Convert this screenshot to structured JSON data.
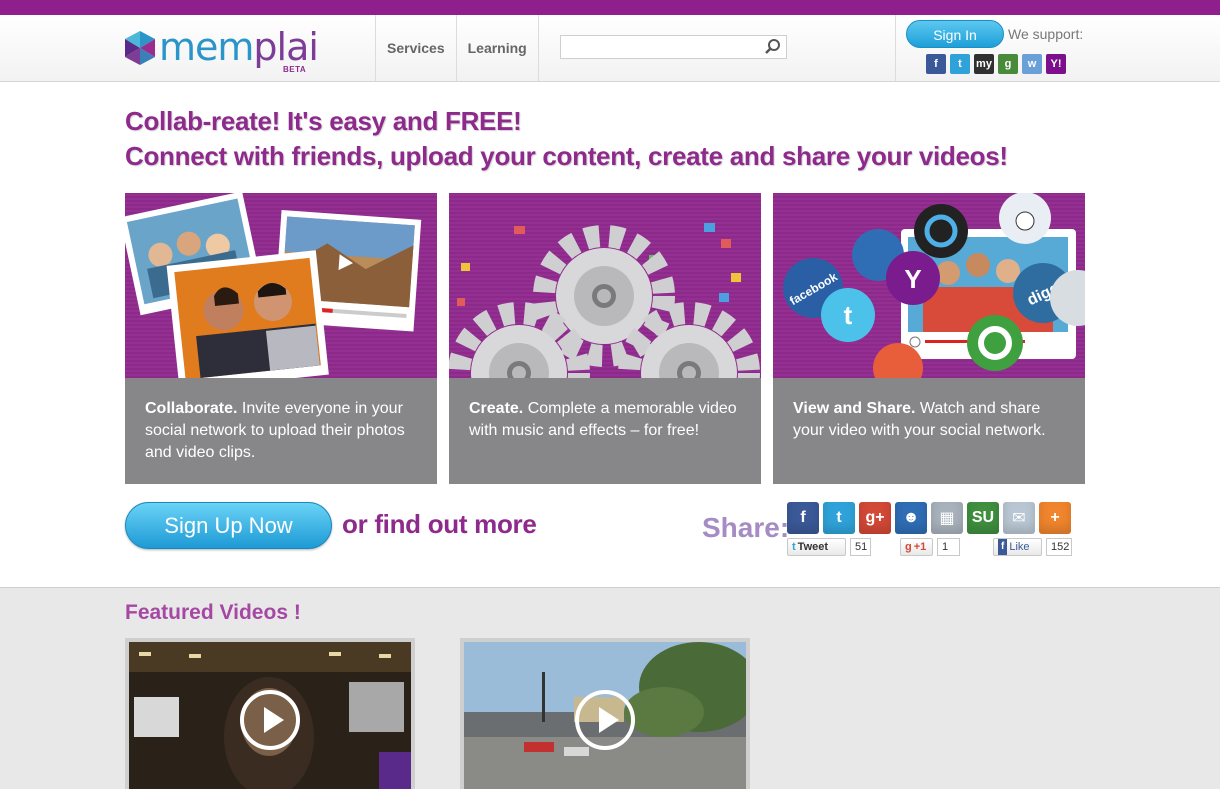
{
  "header": {
    "logo_text_a": "mem",
    "logo_text_b": "plai",
    "logo_badge": "BETA",
    "nav": [
      "Services",
      "Learning"
    ],
    "search_placeholder": "",
    "signin_label": "Sign In",
    "we_support_label": "We support:",
    "support_icons": [
      {
        "icon": "facebook-icon",
        "glyph": "f",
        "color": "#3b5998"
      },
      {
        "icon": "twitter-icon",
        "glyph": "t",
        "color": "#2fa3d9"
      },
      {
        "icon": "myspace-icon",
        "glyph": "my",
        "color": "#303030"
      },
      {
        "icon": "google-icon",
        "glyph": "g",
        "color": "#4a8a3b"
      },
      {
        "icon": "windows-icon",
        "glyph": "w",
        "color": "#6aa0d8"
      },
      {
        "icon": "yahoo-icon",
        "glyph": "Y!",
        "color": "#7b0f8c"
      }
    ]
  },
  "headline": {
    "line1": "Collab-reate! It's easy and FREE!",
    "line2": "Connect with friends, upload your content, create and share your videos!"
  },
  "features": [
    {
      "title": "Collaborate.",
      "text": "Invite everyone in your social network to upload their photos and video clips."
    },
    {
      "title": "Create.",
      "text": "Complete a memorable video with music and effects – for free!"
    },
    {
      "title": "View and Share.",
      "text": "Watch and share your video with your social network."
    }
  ],
  "feature_art": {
    "social_labels": [
      "facebook",
      "digg"
    ]
  },
  "cta": {
    "signup_label": "Sign Up Now",
    "findout_label": "or find out more"
  },
  "share": {
    "label": "Share:",
    "icons": [
      {
        "icon": "facebook-icon",
        "glyph": "f",
        "color": "#3b5998"
      },
      {
        "icon": "twitter-icon",
        "glyph": "t",
        "color": "#2fa3d9"
      },
      {
        "icon": "google-plus-icon",
        "glyph": "g+",
        "color": "#d34836"
      },
      {
        "icon": "myspace-icon",
        "glyph": "☻",
        "color": "#2f6db5"
      },
      {
        "icon": "delicious-icon",
        "glyph": "▦",
        "color": "#a8b2bc"
      },
      {
        "icon": "stumbleupon-icon",
        "glyph": "SU",
        "color": "#3f8f3f"
      },
      {
        "icon": "email-icon",
        "glyph": "✉",
        "color": "#b9c7d4"
      },
      {
        "icon": "more-icon",
        "glyph": "+",
        "color": "#f0852d"
      }
    ],
    "tweet_label": "Tweet",
    "tweet_count": "51",
    "gplus_label": "+1",
    "gplus_count": "1",
    "like_label": "Like",
    "like_count": "152"
  },
  "featured": {
    "title": "Featured Videos !"
  }
}
